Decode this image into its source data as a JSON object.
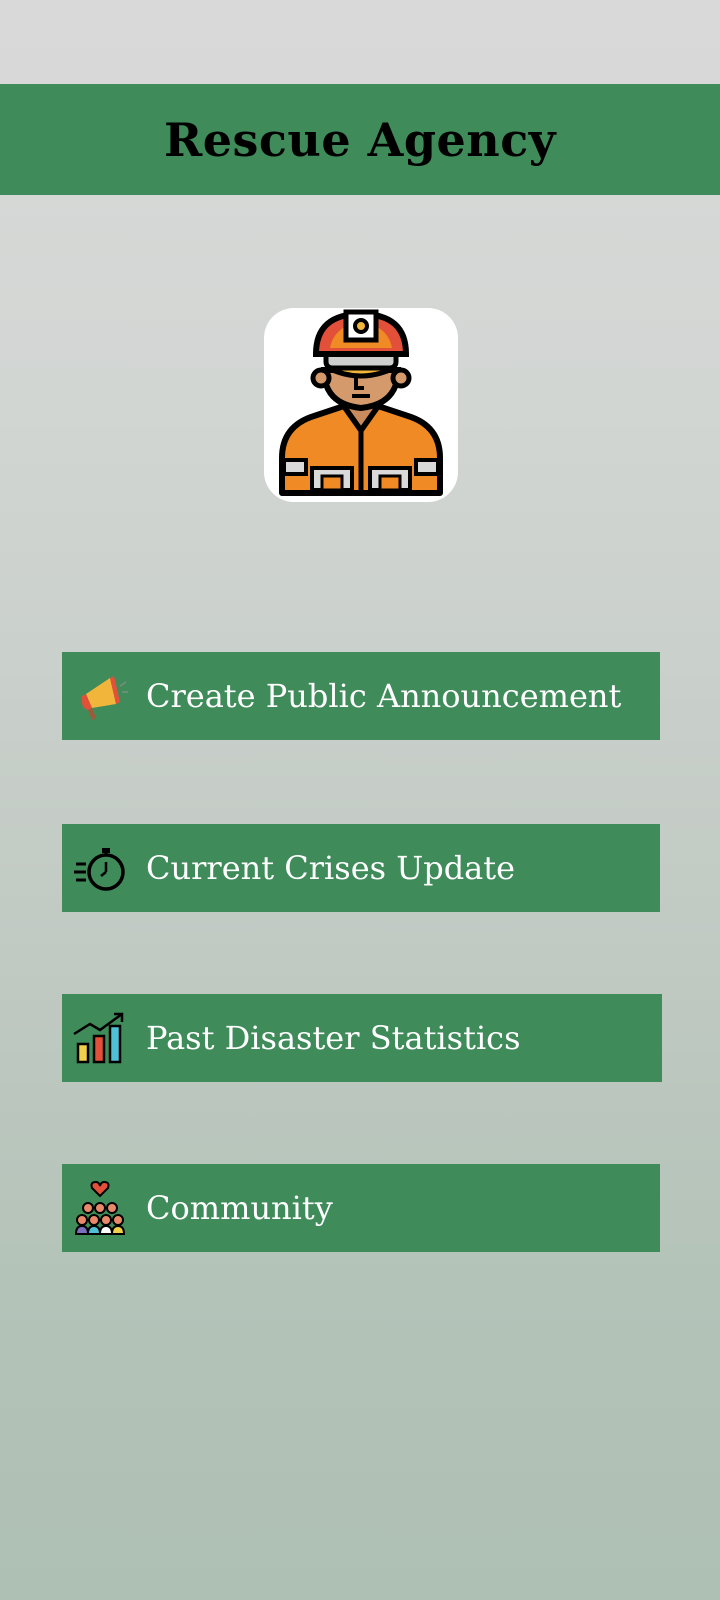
{
  "header": {
    "title": "Rescue Agency"
  },
  "avatar": {
    "icon": "rescue-worker-icon"
  },
  "menu": [
    {
      "label": "Create Public Announcement",
      "icon": "megaphone-icon"
    },
    {
      "label": "Current Crises Update",
      "icon": "stopwatch-icon"
    },
    {
      "label": "Past Disaster Statistics",
      "icon": "bar-chart-icon"
    },
    {
      "label": "Community",
      "icon": "community-icon"
    }
  ],
  "colors": {
    "header_bg": "#3f8b5a",
    "button_bg": "#3f8b5a",
    "title_text": "#000000",
    "button_text": "#ffffff"
  }
}
